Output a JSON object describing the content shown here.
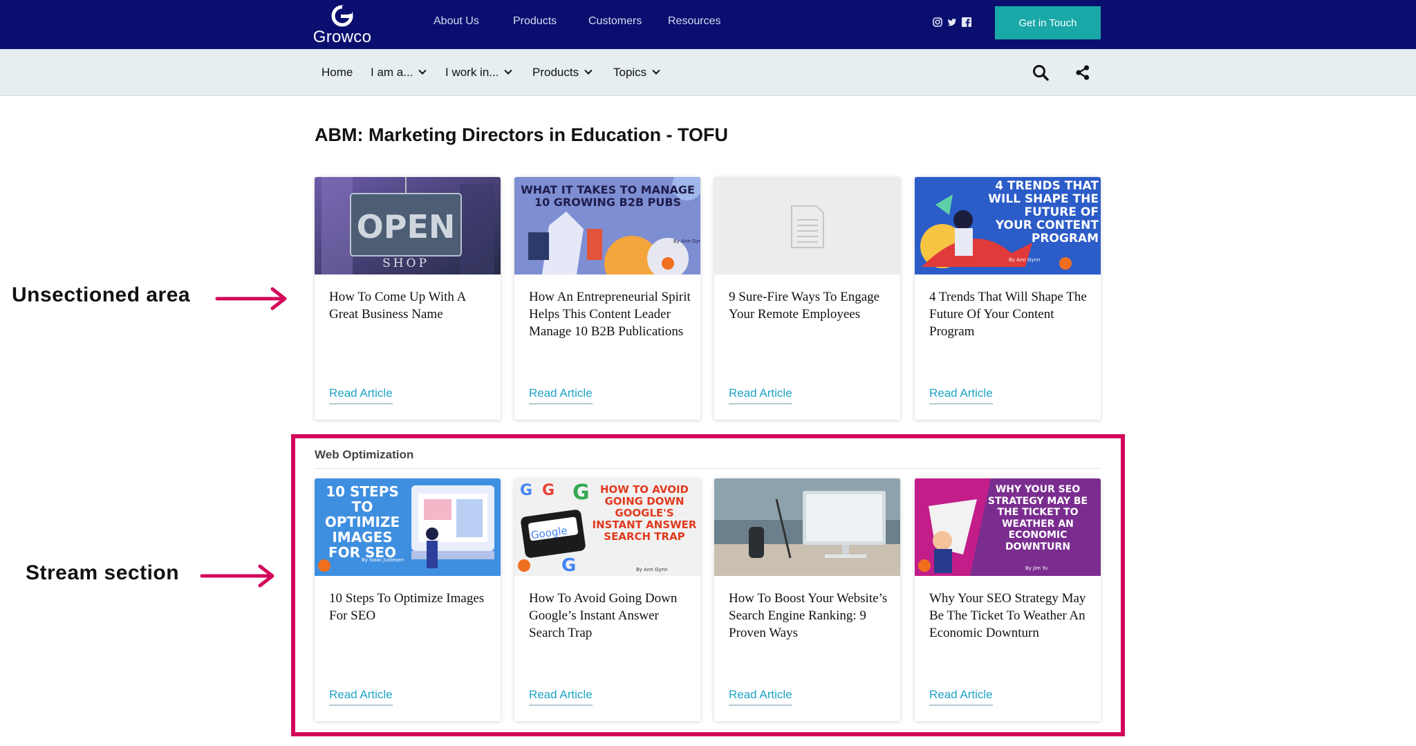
{
  "header": {
    "logo_text": "Growco",
    "nav": [
      "About Us",
      "Products",
      "Customers",
      "Resources"
    ],
    "social_icons": [
      "instagram-icon",
      "twitter-icon",
      "facebook-icon"
    ],
    "cta_label": "Get in Touch",
    "bg_color": "#0a0e6e",
    "cta_color": "#1aa7a8"
  },
  "subnav": {
    "items": [
      "Home",
      "I am a...",
      "I work in...",
      "Products",
      "Topics"
    ],
    "icons": [
      "search-icon",
      "share-icon"
    ]
  },
  "page_title": "ABM: Marketing Directors in Education - TOFU",
  "annotations": {
    "unsectioned": "Unsectioned area",
    "stream": "Stream section",
    "highlight_color": "#d3085a"
  },
  "unsectioned_cards": [
    {
      "title": "How To Come Up With A Great Business Name",
      "cta": "Read Article",
      "thumb_text": "OPEN",
      "thumb_sub": "SHOP"
    },
    {
      "title": "How An Entrepreneurial Spirit Helps This Content Leader Manage 10 B2B Publications",
      "cta": "Read Article",
      "thumb_text": "WHAT IT TAKES TO MANAGE 10 GROWING B2B PUBS",
      "thumb_sub": "By Ann Gynn"
    },
    {
      "title": "9 Sure-Fire Ways To Engage Your Remote Employees",
      "cta": "Read Article"
    },
    {
      "title": "4 Trends That Will Shape The Future Of Your Content Program",
      "cta": "Read Article",
      "thumb_text": "4 TRENDS THAT WILL SHAPE THE FUTURE OF YOUR CONTENT PROGRAM",
      "thumb_sub": "By Ann Gynn"
    }
  ],
  "stream_section": {
    "label": "Web Optimization",
    "cards": [
      {
        "title": "10 Steps To Optimize Images For SEO",
        "cta": "Read Article",
        "thumb_text": "10 STEPS TO OPTIMIZE IMAGES FOR SEO",
        "thumb_sub": "By Isaac Justesen"
      },
      {
        "title": "How To Avoid Going Down Google’s Instant Answer Search Trap",
        "cta": "Read Article",
        "thumb_text": "HOW TO AVOID GOING DOWN GOOGLE'S INSTANT ANSWER SEARCH TRAP",
        "thumb_sub": "By Ann Gynn",
        "thumb_logo": "Google"
      },
      {
        "title": "How To Boost Your Website’s Search Engine Ranking: 9 Proven Ways",
        "cta": "Read Article"
      },
      {
        "title": "Why Your SEO Strategy May Be The Ticket To Weather An Economic Downturn",
        "cta": "Read Article",
        "thumb_text": "WHY YOUR SEO STRATEGY MAY BE THE TICKET TO WEATHER AN ECONOMIC DOWNTURN",
        "thumb_sub": "By Jim Yu"
      }
    ]
  }
}
